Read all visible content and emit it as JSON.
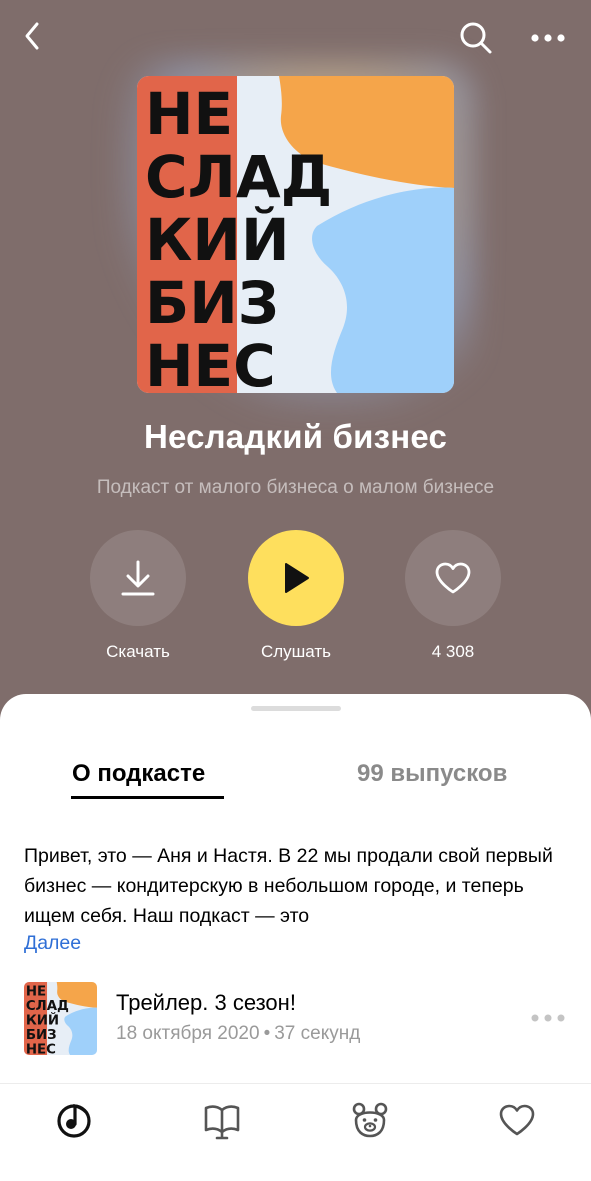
{
  "header": {
    "back_icon": "chevron-left-icon",
    "search_icon": "search-icon",
    "more_icon": "more-dots-icon"
  },
  "cover": {
    "lines": [
      "НЕ",
      "СЛАД",
      "КИЙ",
      "БИЗ",
      "НЕС"
    ],
    "colors": {
      "red": "#e1654a",
      "orange": "#f5a54a",
      "light": "#e7eef6",
      "blue": "#9fd0fa",
      "text": "#111111"
    }
  },
  "podcast": {
    "title": "Несладкий бизнес",
    "subtitle": "Подкаст от малого бизнеса о малом бизнесе"
  },
  "actions": {
    "download_label": "Скачать",
    "listen_label": "Слушать",
    "likes_count": "4 308",
    "play_color": "#fedf5d"
  },
  "tabs": {
    "about": "О подкасте",
    "episodes": "99 выпусков"
  },
  "about": {
    "description": "Привет, это — Аня и Настя. В 22 мы продали свой первый бизнес — кондитерскую в небольшом городе, и теперь ищем себя. Наш подкаст — это",
    "more_link": "Далее"
  },
  "episode": {
    "title": "Трейлер. 3 сезон!",
    "date": "18 октября 2020",
    "separator": "•",
    "duration": "37 секунд"
  },
  "tabbar": {
    "items": [
      "music-note-icon",
      "book-icon",
      "bear-icon",
      "heart-icon"
    ]
  }
}
